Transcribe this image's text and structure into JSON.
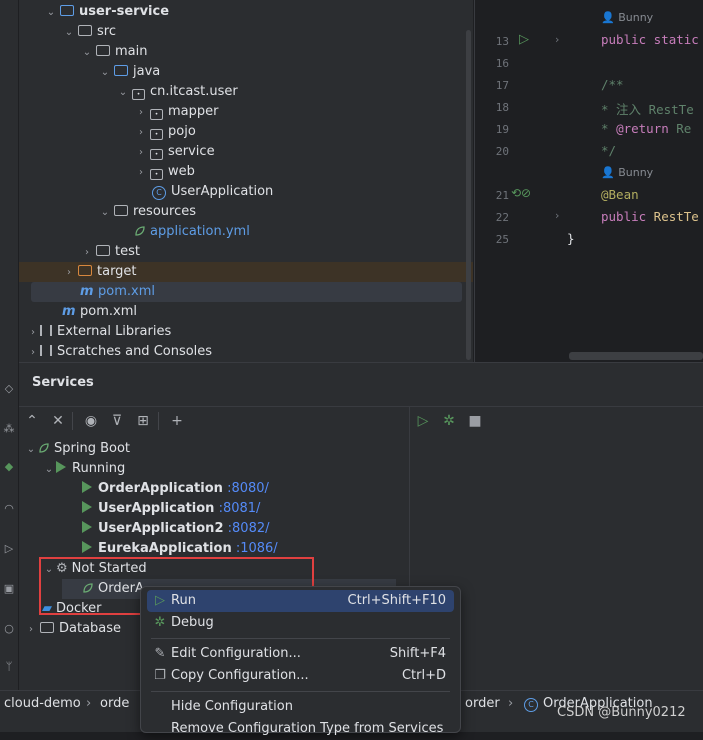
{
  "project": {
    "rows": [
      {
        "label": "user-service",
        "indent": 0
      },
      {
        "label": "src"
      },
      {
        "label": "main"
      },
      {
        "label": "java"
      },
      {
        "label": "cn.itcast.user"
      },
      {
        "label": "mapper"
      },
      {
        "label": "pojo"
      },
      {
        "label": "service"
      },
      {
        "label": "web"
      },
      {
        "label": "UserApplication"
      },
      {
        "label": "resources"
      },
      {
        "label": "application.yml"
      },
      {
        "label": "test"
      },
      {
        "label": "target"
      },
      {
        "label": "pom.xml"
      },
      {
        "label": "pom.xml"
      },
      {
        "label": "External Libraries"
      },
      {
        "label": "Scratches and Consoles"
      }
    ]
  },
  "editor": {
    "lines": [
      {
        "num": "",
        "hint": "Bunny"
      },
      {
        "num": "13",
        "text_kw": "public static"
      },
      {
        "num": "16"
      },
      {
        "num": "17",
        "comment": "/**"
      },
      {
        "num": "18",
        "comment": " * 注入 RestTe"
      },
      {
        "num": "19",
        "comment_pre": " * ",
        "comment_tag": "@return",
        "comment_post": " Re"
      },
      {
        "num": "20",
        "comment": " */"
      },
      {
        "num": "",
        "hint": "Bunny"
      },
      {
        "num": "21",
        "annotation": "@Bean"
      },
      {
        "num": "22",
        "text_kw": "public",
        "text_rest": " RestTe"
      },
      {
        "num": "25",
        "brace": "}"
      }
    ]
  },
  "services": {
    "title": "Services",
    "tree": {
      "spring_boot": "Spring Boot",
      "running": "Running",
      "apps": [
        {
          "name": "OrderApplication",
          "port": ":8080/"
        },
        {
          "name": "UserApplication",
          "port": ":8081/"
        },
        {
          "name": "UserApplication2",
          "port": ":8082/"
        },
        {
          "name": "EurekaApplication",
          "port": ":1086/"
        }
      ],
      "not_started": "Not Started",
      "order_truncated": "OrderA",
      "docker": "Docker",
      "database": "Database"
    }
  },
  "context_menu": {
    "items": [
      {
        "label": "Run",
        "shortcut": "Ctrl+Shift+F10",
        "icon": "run-icon"
      },
      {
        "label": "Debug",
        "shortcut": "",
        "icon": "debug-icon"
      },
      {
        "label": "Edit Configuration...",
        "shortcut": "Shift+F4",
        "icon": "edit-icon"
      },
      {
        "label": "Copy Configuration...",
        "shortcut": "Ctrl+D",
        "icon": "copy-icon"
      },
      {
        "label": "Hide Configuration",
        "shortcut": ""
      },
      {
        "label": "Remove Configuration Type from Services",
        "shortcut": ""
      }
    ]
  },
  "statusbar": {
    "crumbs": [
      "cloud-demo",
      "orde",
      "order",
      "OrderApplication"
    ]
  },
  "watermark": "CSDN @Bunny0212",
  "colors": {
    "accent": "#548af7",
    "run": "#57965c",
    "highlight": "#e04040",
    "selection": "#2e436e"
  }
}
